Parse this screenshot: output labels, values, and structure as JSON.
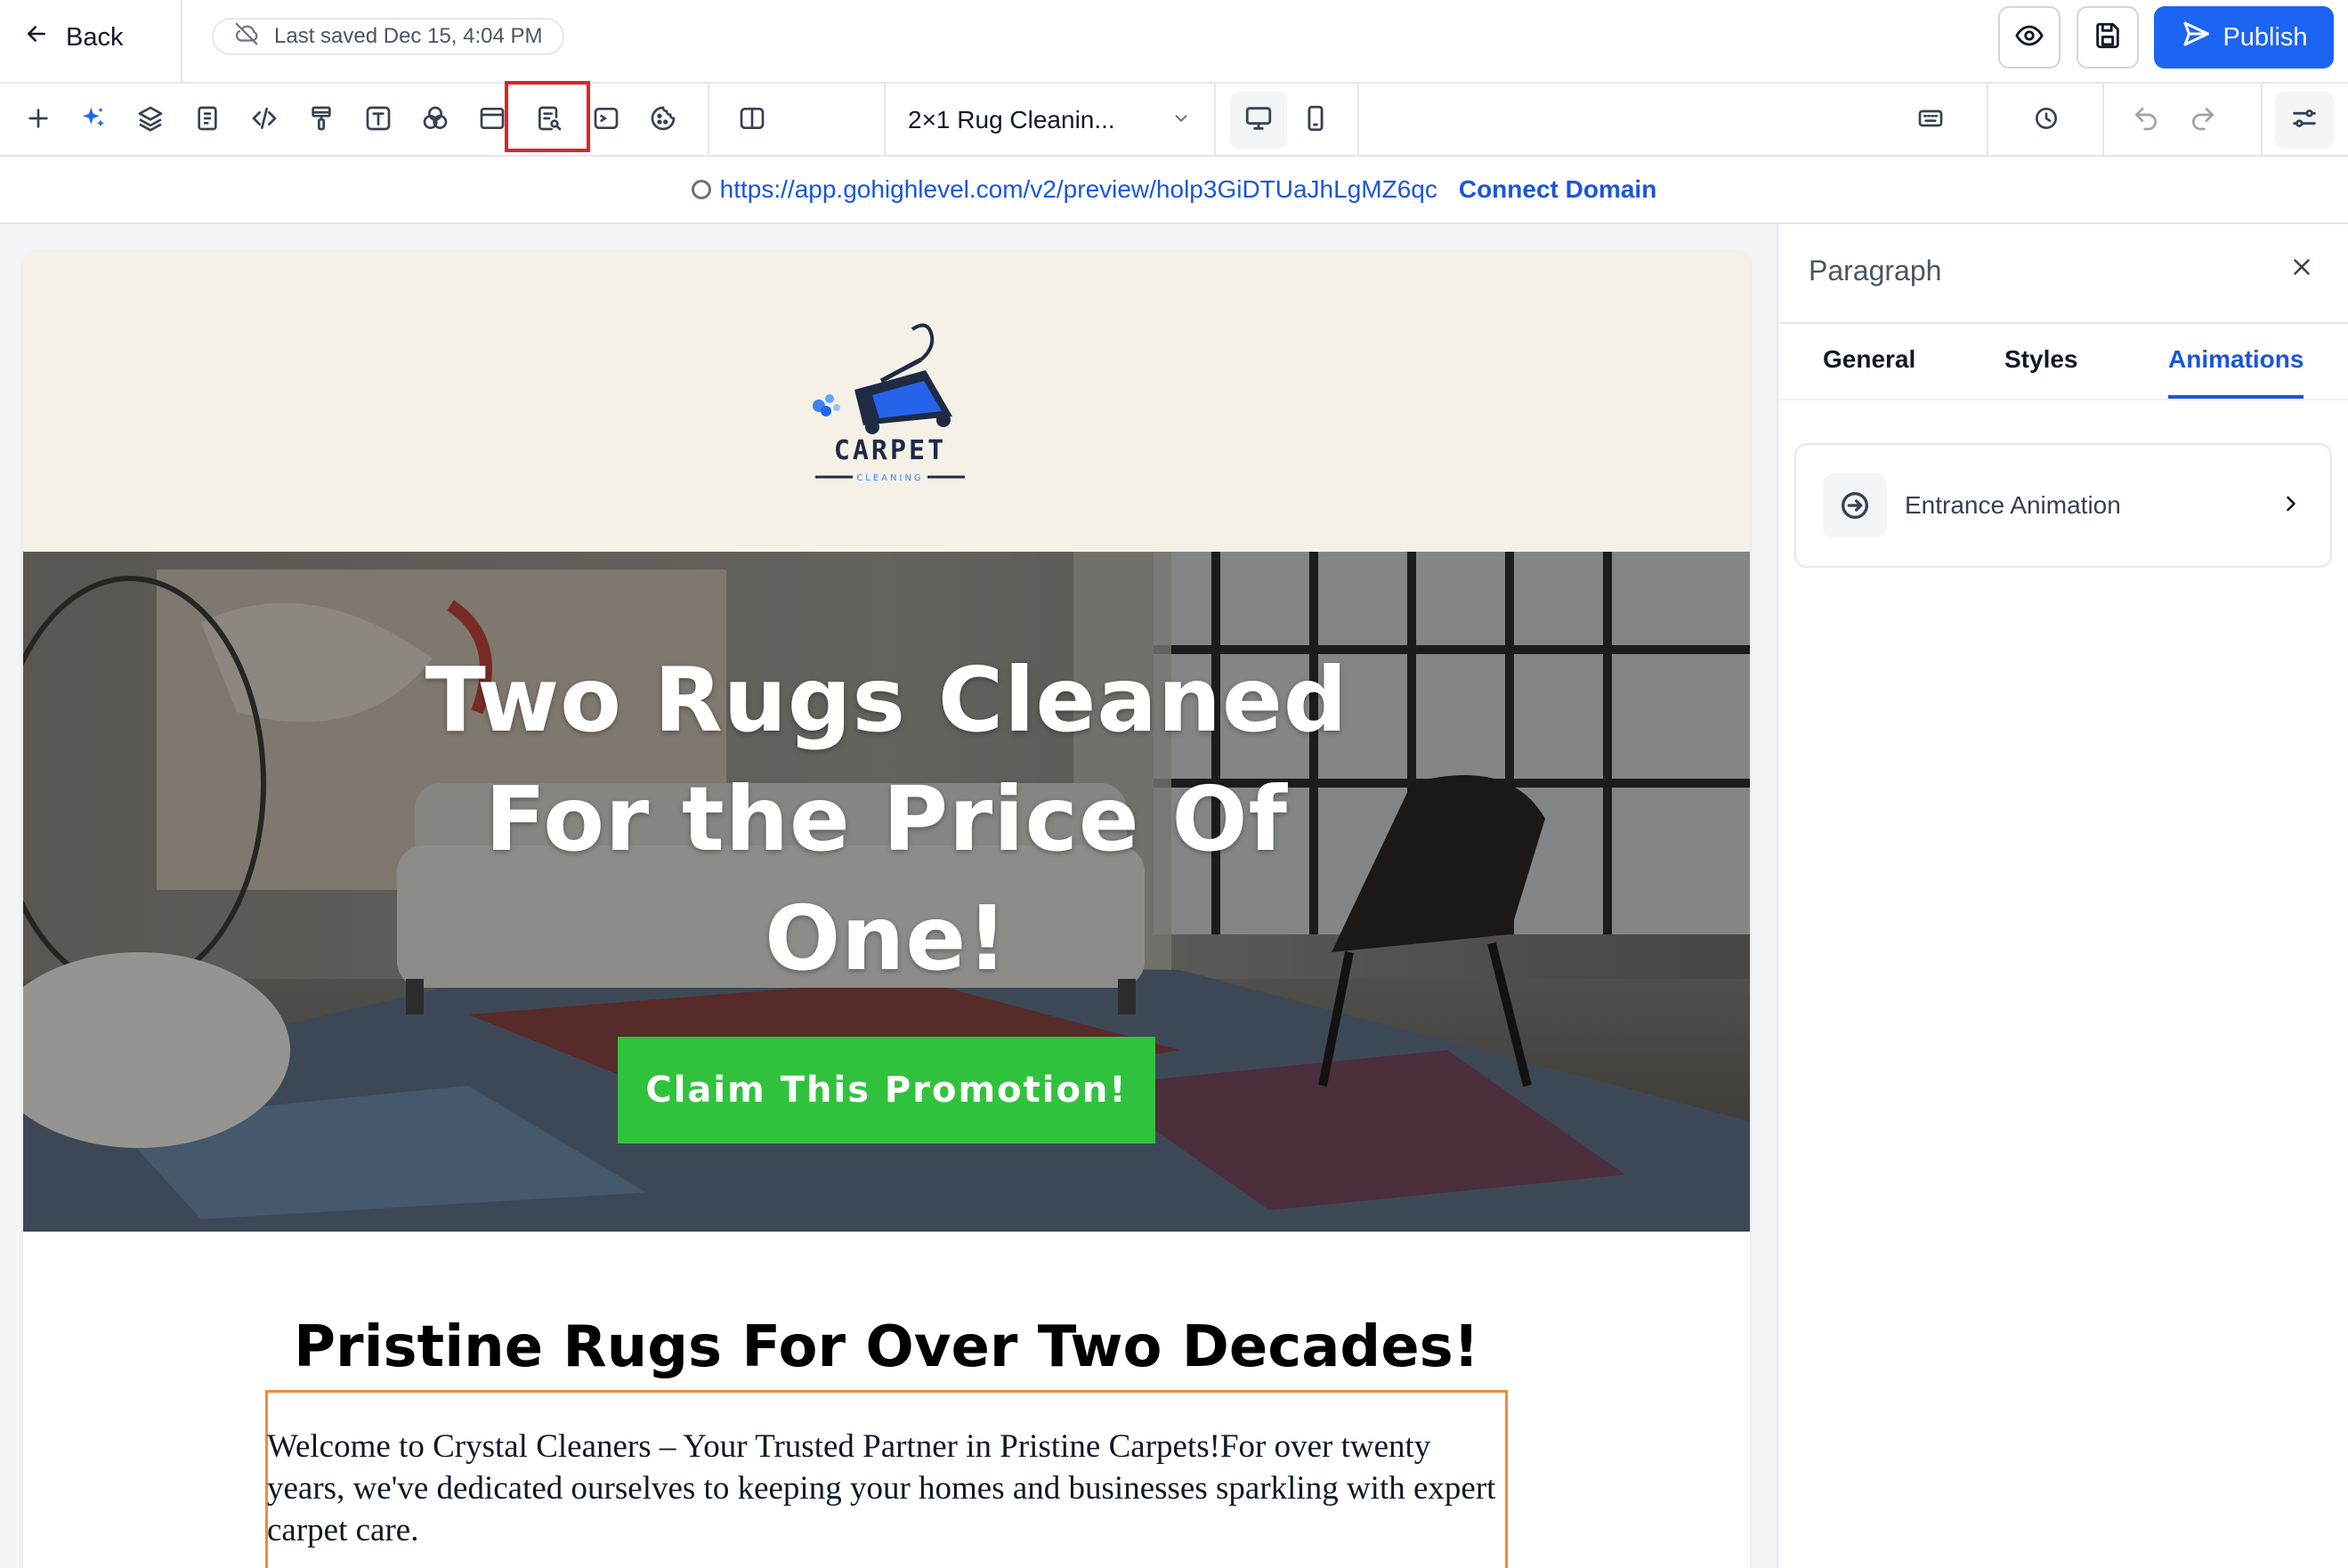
{
  "topbar": {
    "back_label": "Back",
    "last_saved": "Last saved Dec 15, 4:04 PM",
    "publish_label": "Publish"
  },
  "toolbar": {
    "page_name": "2×1 Rug Cleanin..."
  },
  "urlbar": {
    "url": "https://app.gohighlevel.com/v2/preview/holp3GiDTUaJhLgMZ6qc",
    "connect_label": "Connect Domain"
  },
  "canvas": {
    "logo_word": "CARPET",
    "logo_sub": "CLEANING",
    "hero_title_lines": [
      "Two Rugs Cleaned",
      "For the Price Of",
      "One!"
    ],
    "cta_label": "Claim This Promotion!",
    "section_heading": "Pristine Rugs For Over Two Decades!",
    "paragraph": "Welcome to Crystal Cleaners – Your Trusted Partner in Pristine Carpets!For over twenty years, we've dedicated ourselves to keeping your homes and businesses sparkling with expert carpet care."
  },
  "panel": {
    "title": "Paragraph",
    "tabs": [
      {
        "label": "General",
        "active": false
      },
      {
        "label": "Styles",
        "active": false
      },
      {
        "label": "Animations",
        "active": true
      }
    ],
    "entrance_label": "Entrance Animation"
  },
  "colors": {
    "accent": "#1c64f2",
    "cta": "#31c23d",
    "selection_outline": "#f08a3c",
    "highlight": "#e02424",
    "header_bg": "#f5f1e6"
  }
}
